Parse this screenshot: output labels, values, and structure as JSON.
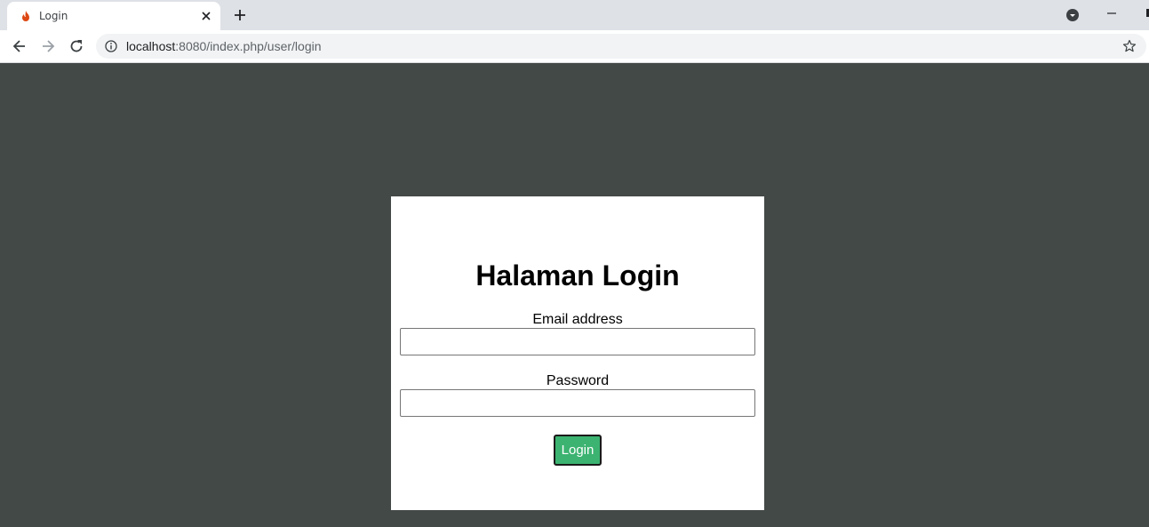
{
  "browser": {
    "tab_title": "Login",
    "url_host": "localhost",
    "url_rest": ":8080/index.php/user/login"
  },
  "icons": {
    "favicon": "flame-icon",
    "tab_close": "close-icon",
    "new_tab": "plus-icon",
    "back": "arrow-left-icon",
    "forward": "arrow-right-icon",
    "reload": "reload-icon",
    "info": "info-icon",
    "bookmark": "star-icon",
    "profile": "chevron-down-circle-icon",
    "minimize": "minimize-icon"
  },
  "login": {
    "heading": "Halaman Login",
    "email_label": "Email address",
    "email_value": "",
    "password_label": "Password",
    "password_value": "",
    "submit_label": "Login"
  },
  "colors": {
    "page_background": "#434947",
    "card_background": "#ffffff",
    "button_background": "#3cb371"
  }
}
